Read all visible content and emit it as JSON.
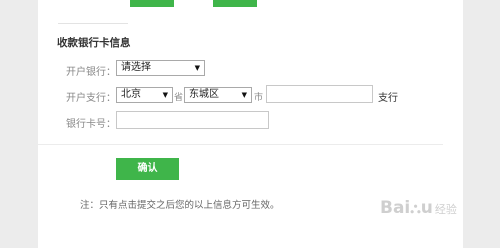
{
  "section_title": "收款银行卡信息",
  "bank": {
    "label": "开户银行：",
    "selected": "请选择"
  },
  "branch": {
    "label": "开户支行：",
    "province": "北京",
    "province_suffix": "省",
    "city": "东城区",
    "city_suffix": "市",
    "branch_suffix": "支行"
  },
  "card": {
    "label": "银行卡号："
  },
  "confirm_label": "确认",
  "note": "注：只有点击提交之后您的以上信息方可生效。",
  "watermark": {
    "text": "Bai",
    "paw": "⛬",
    "tail": "u",
    "sub": "经验"
  },
  "colors": {
    "accent": "#3fb54a",
    "background": "#ececec",
    "panel": "#ffffff"
  },
  "icons": {
    "select_arrow": "triangle-down-icon"
  }
}
